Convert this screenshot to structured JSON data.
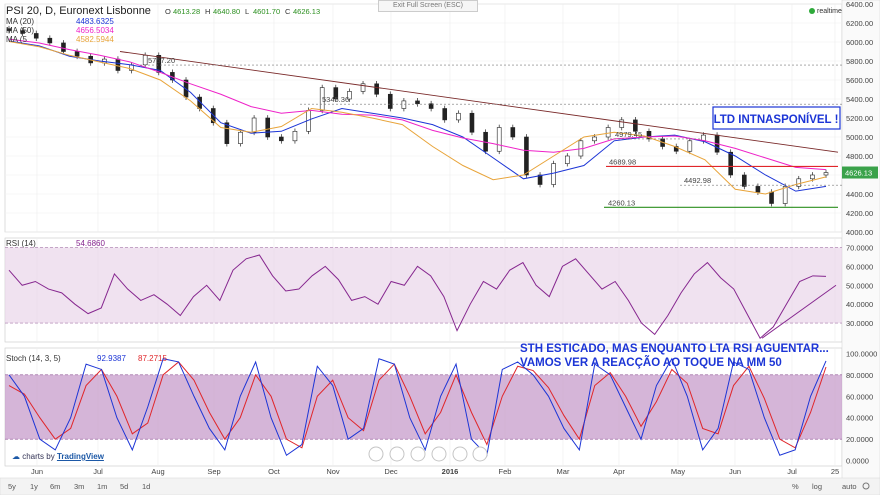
{
  "toolbar": {
    "exit_full_screen": "Exit Full Screen (ESC)",
    "realtime": "realtime",
    "branding_prefix": "charts by",
    "branding_name": "TradingView",
    "range_buttons": [
      "5y",
      "1y",
      "6m",
      "3m",
      "1m",
      "5d",
      "1d"
    ],
    "right_buttons": [
      "%",
      "log",
      "auto"
    ]
  },
  "header": {
    "symbol": "PSI 20, D, Euronext Lisbonne",
    "ohlc": [
      {
        "label": "O",
        "value": "4613.28"
      },
      {
        "label": "H",
        "value": "4640.80"
      },
      {
        "label": "L",
        "value": "4601.70"
      },
      {
        "label": "C",
        "value": "4626.13"
      }
    ]
  },
  "legend": {
    "ma20": {
      "label": "MA (20)",
      "value": "4483.6325",
      "color": "#1c35d6"
    },
    "ma50": {
      "label": "MA (50)",
      "value": "4656.5034",
      "color": "#ee22c8"
    },
    "ma_c": {
      "label": "MA (5",
      "value": "4582.5944",
      "color": "#e8a43a"
    }
  },
  "colors": {
    "price": "#333333",
    "ma20": "#1c35d6",
    "ma50": "#ee22c8",
    "ma_c": "#e8a43a",
    "rsi": "#86278f",
    "stoch_k": "#1c35d6",
    "stoch_d": "#e0262a",
    "annotation": "#1c35d6",
    "red_line": "#e0262a",
    "green_line": "#2b8f1f",
    "pink_band": "#e9d6ea",
    "stoch_band": "#c79ccb"
  },
  "chart_data": [
    {
      "type": "line",
      "title": "PSI 20, D, Euronext Lisbonne",
      "y_ticks": [
        "6400.00",
        "6200.00",
        "6000.00",
        "5800.00",
        "5600.00",
        "5400.00",
        "5200.00",
        "5000.00",
        "4800.00",
        "4600.00",
        "4400.00",
        "4200.00",
        "4000.00"
      ],
      "ylim": [
        4000,
        6400
      ],
      "x_ticks": [
        "Jun",
        "Jul",
        "Aug",
        "Sep",
        "Oct",
        "Nov",
        "Dec",
        "2016",
        "Feb",
        "Mar",
        "Apr",
        "May",
        "Jun",
        "Jul",
        "25"
      ],
      "last_price_label": "4626.13",
      "series": [
        {
          "name": "MA (20)",
          "values": [
            6010,
            5960,
            5850,
            5800,
            5760,
            5700,
            5470,
            5150,
            5040,
            5060,
            5190,
            5300,
            5250,
            5200,
            5130,
            5000,
            4780,
            4560,
            4620,
            4700,
            4960,
            5000,
            5020,
            4950,
            4800,
            4600,
            4430,
            4480
          ]
        },
        {
          "name": "MA (50)",
          "values": [
            6030,
            5990,
            5920,
            5860,
            5790,
            5680,
            5560,
            5450,
            5320,
            5250,
            5280,
            5240,
            5230,
            5180,
            5070,
            4990,
            4930,
            4860,
            4840,
            4880,
            4980,
            5000,
            5010,
            4960,
            4880,
            4780,
            4680,
            4656
          ]
        },
        {
          "name": "MA (5",
          "values": [
            6005,
            5950,
            5860,
            5790,
            5720,
            5600,
            5380,
            5100,
            5050,
            5110,
            5300,
            5260,
            5200,
            5130,
            4900,
            4700,
            4550,
            4600,
            4800,
            5000,
            5050,
            5010,
            4900,
            4760,
            4450,
            4400,
            4500,
            4580
          ]
        }
      ],
      "price_path": [
        6120,
        6090,
        6040,
        5990,
        5900,
        5850,
        5780,
        5820,
        5700,
        5760,
        5860,
        5680,
        5600,
        5420,
        5300,
        5150,
        4930,
        5050,
        5200,
        5000,
        4960,
        5060,
        5280,
        5520,
        5400,
        5480,
        5560,
        5450,
        5300,
        5380,
        5350,
        5300,
        5180,
        5250,
        5050,
        4850,
        5100,
        5000,
        4600,
        4500,
        4720,
        4800,
        4960,
        5000,
        5100,
        5180,
        5060,
        4980,
        4900,
        4850,
        4960,
        5020,
        4840,
        4600,
        4480,
        4420,
        4300,
        4480,
        4560,
        4600,
        4626.13
      ],
      "annotations": [
        {
          "text": "5757.20",
          "value": 5757.2
        },
        {
          "text": "5345.36",
          "value": 5345.36
        },
        {
          "text": "4979.45",
          "value": 4979.45
        },
        {
          "text": "4689.98",
          "value": 4689.98
        },
        {
          "text": "4492.98",
          "value": 4492.98
        },
        {
          "text": "4260.13",
          "value": 4260.13
        }
      ],
      "trendline": {
        "from": 5900,
        "to": 4840
      },
      "label_box": "LTD INTNASPONÍVEL !"
    },
    {
      "type": "line",
      "title": "RSI (14)",
      "value_label": "54.6860",
      "y_ticks": [
        "70.0000",
        "60.0000",
        "50.0000",
        "40.0000",
        "30.0000"
      ],
      "ylim": [
        20,
        75
      ],
      "band": [
        30,
        70
      ],
      "series": [
        {
          "name": "RSI (14)",
          "values": [
            58,
            50,
            52,
            48,
            46,
            40,
            35,
            38,
            56,
            48,
            42,
            45,
            40,
            34,
            44,
            50,
            42,
            58,
            64,
            66,
            55,
            47,
            48,
            55,
            60,
            53,
            42,
            44,
            40,
            52,
            50,
            60,
            55,
            44,
            26,
            40,
            52,
            48,
            58,
            62,
            50,
            44,
            60,
            64,
            56,
            48,
            52,
            42,
            30,
            24,
            34,
            46,
            56,
            62,
            54,
            48,
            35,
            22,
            28,
            40,
            52,
            55,
            54.686
          ]
        },
        {
          "name": "trend",
          "values": [
            22,
            50
          ]
        }
      ]
    },
    {
      "type": "line",
      "title": "Stoch (14, 3, 5)",
      "values_label": [
        "92.9387",
        "87.2715"
      ],
      "y_ticks": [
        "100.0000",
        "80.0000",
        "60.0000",
        "40.0000",
        "20.0000",
        "0.0000"
      ],
      "ylim": [
        -5,
        105
      ],
      "band": [
        20,
        80
      ],
      "series": [
        {
          "name": "K",
          "values": [
            80,
            60,
            20,
            10,
            40,
            90,
            85,
            40,
            10,
            50,
            95,
            92,
            60,
            30,
            10,
            60,
            92,
            40,
            5,
            15,
            88,
            70,
            20,
            30,
            95,
            90,
            40,
            10,
            60,
            90,
            20,
            5,
            85,
            92,
            80,
            60,
            30,
            10,
            90,
            80,
            50,
            20,
            70,
            95,
            60,
            10,
            30,
            92,
            85,
            40,
            5,
            10,
            60,
            92.94
          ]
        },
        {
          "name": "D",
          "values": [
            70,
            62,
            40,
            20,
            30,
            70,
            85,
            60,
            25,
            35,
            80,
            92,
            75,
            45,
            20,
            40,
            80,
            60,
            20,
            12,
            60,
            75,
            40,
            28,
            75,
            90,
            60,
            25,
            45,
            80,
            45,
            15,
            60,
            88,
            84,
            68,
            42,
            20,
            70,
            82,
            60,
            32,
            55,
            85,
            72,
            30,
            25,
            70,
            88,
            58,
            20,
            12,
            45,
            87.27
          ]
        }
      ],
      "note": "STH ESTICADO, MAS ENQUANTO LTA RSI AGUENTAR... VAMOS VER A REACÇÃO AO TOQUE NA MM 50"
    }
  ]
}
